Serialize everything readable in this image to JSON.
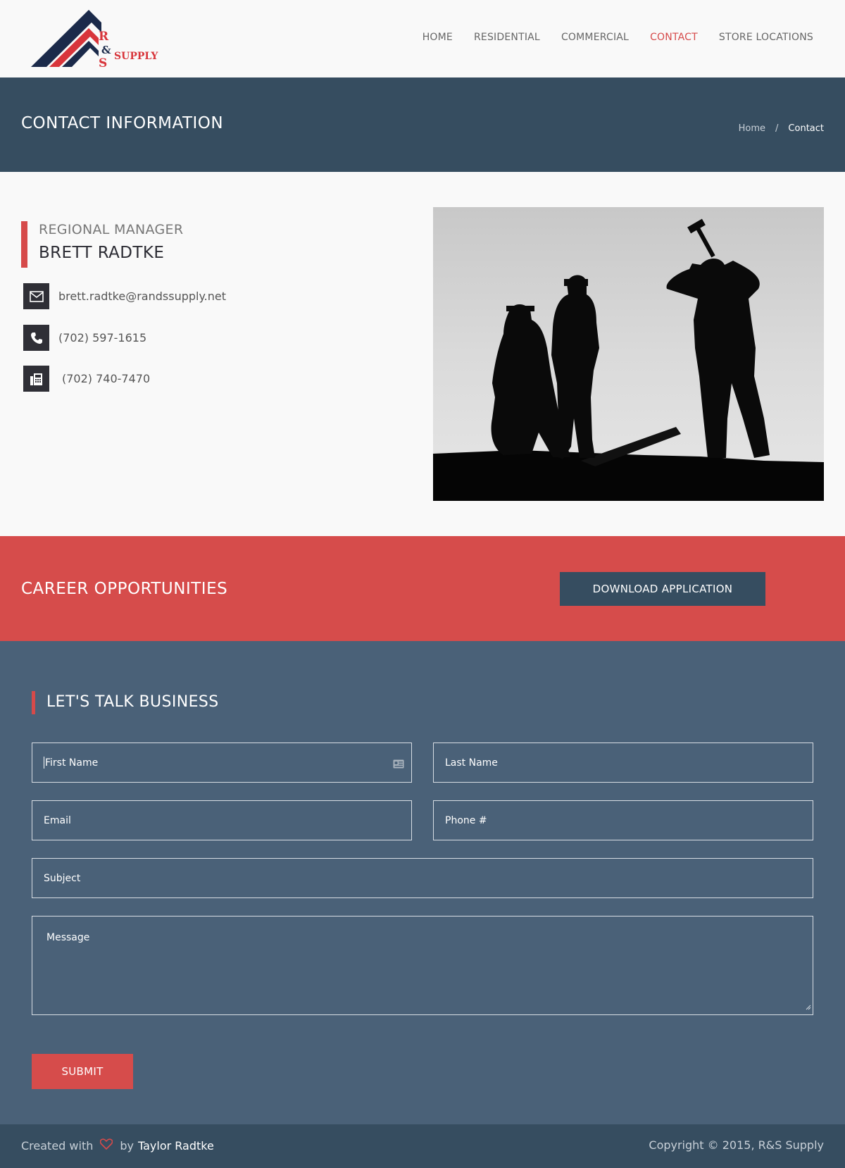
{
  "header": {
    "logo": {
      "letters_top": "R",
      "letters_mid": "&",
      "letters_bottom": "S",
      "word": "SUPPLY"
    },
    "nav": [
      {
        "label": "HOME",
        "active": false
      },
      {
        "label": "RESIDENTIAL",
        "active": false
      },
      {
        "label": "COMMERCIAL",
        "active": false
      },
      {
        "label": "CONTACT",
        "active": true
      },
      {
        "label": "STORE LOCATIONS",
        "active": false
      }
    ]
  },
  "title_band": {
    "title": "CONTACT INFORMATION",
    "breadcrumb": {
      "home": "Home",
      "separator": "/",
      "current": "Contact"
    }
  },
  "contact": {
    "role": "REGIONAL MANAGER",
    "name": "BRETT RADTKE",
    "email": "brett.radtke@randssupply.net",
    "phone": "(702) 597-1615",
    "fax": "(702) 740-7470",
    "icons": {
      "email": "envelope-icon",
      "phone": "phone-icon",
      "fax": "fax-icon"
    }
  },
  "career": {
    "title": "CAREER OPPORTUNITIES",
    "button_label": "DOWNLOAD APPLICATION"
  },
  "form": {
    "heading": "LET'S TALK BUSINESS",
    "first_name_placeholder": "First Name",
    "last_name_placeholder": "Last Name",
    "email_placeholder": "Email",
    "phone_placeholder": "Phone #",
    "subject_placeholder": "Subject",
    "message_placeholder": "Message",
    "submit_label": "SUBMIT"
  },
  "footer": {
    "created_with": "Created with",
    "by": "by",
    "author": "Taylor Radtke",
    "copyright": "Copyright © 2015, R&S Supply"
  },
  "colors": {
    "accent_red": "#d64a4a",
    "dark_navy": "#364d60",
    "form_blue": "#4a6178",
    "logo_navy": "#1b2a4a"
  }
}
